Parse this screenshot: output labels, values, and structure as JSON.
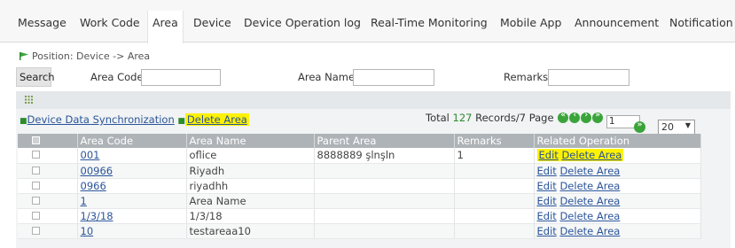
{
  "tabs": [
    "Message",
    "Work Code",
    "Area",
    "Device",
    "Device Operation log",
    "Real-Time Monitoring",
    "Mobile App",
    "Announcement",
    "Notification"
  ],
  "active_tab": "Area",
  "position": "Position: Device -> Area",
  "search": {
    "button": "Search",
    "area_code_label": "Area Code",
    "area_code_value": "",
    "area_name_label": "Area Name",
    "area_name_value": "",
    "remarks_label": "Remarks",
    "remarks_value": ""
  },
  "actions": {
    "device_sync": "Device Data Synchronization",
    "delete_area": "Delete Area"
  },
  "pager": {
    "total_prefix": "Total",
    "total": "127",
    "records_pages": "Records/7",
    "page_label": "Page",
    "page_value": "1",
    "page_size": "20"
  },
  "table": {
    "headers": [
      "Area Code",
      "Area Name",
      "Parent Area",
      "Remarks",
      "Related Operation"
    ],
    "edit_label": "Edit",
    "delete_label": "Delete Area",
    "rows": [
      {
        "code": "001",
        "name": "oflice",
        "parent": "8888889 şlnşln",
        "remarks": "1"
      },
      {
        "code": "00966",
        "name": "Riyadh",
        "parent": "",
        "remarks": ""
      },
      {
        "code": "0966",
        "name": "riyadhh",
        "parent": "",
        "remarks": ""
      },
      {
        "code": "1",
        "name": "Area Name",
        "parent": "",
        "remarks": ""
      },
      {
        "code": "1/3/18",
        "name": "1/3/18",
        "parent": "",
        "remarks": ""
      },
      {
        "code": "10",
        "name": "testareaa10",
        "parent": "",
        "remarks": ""
      }
    ]
  },
  "colors": {
    "highlight": "#fff200",
    "link": "#2a5599",
    "header_bg": "#aeb3b7",
    "pager_green": "#3aa43a"
  }
}
